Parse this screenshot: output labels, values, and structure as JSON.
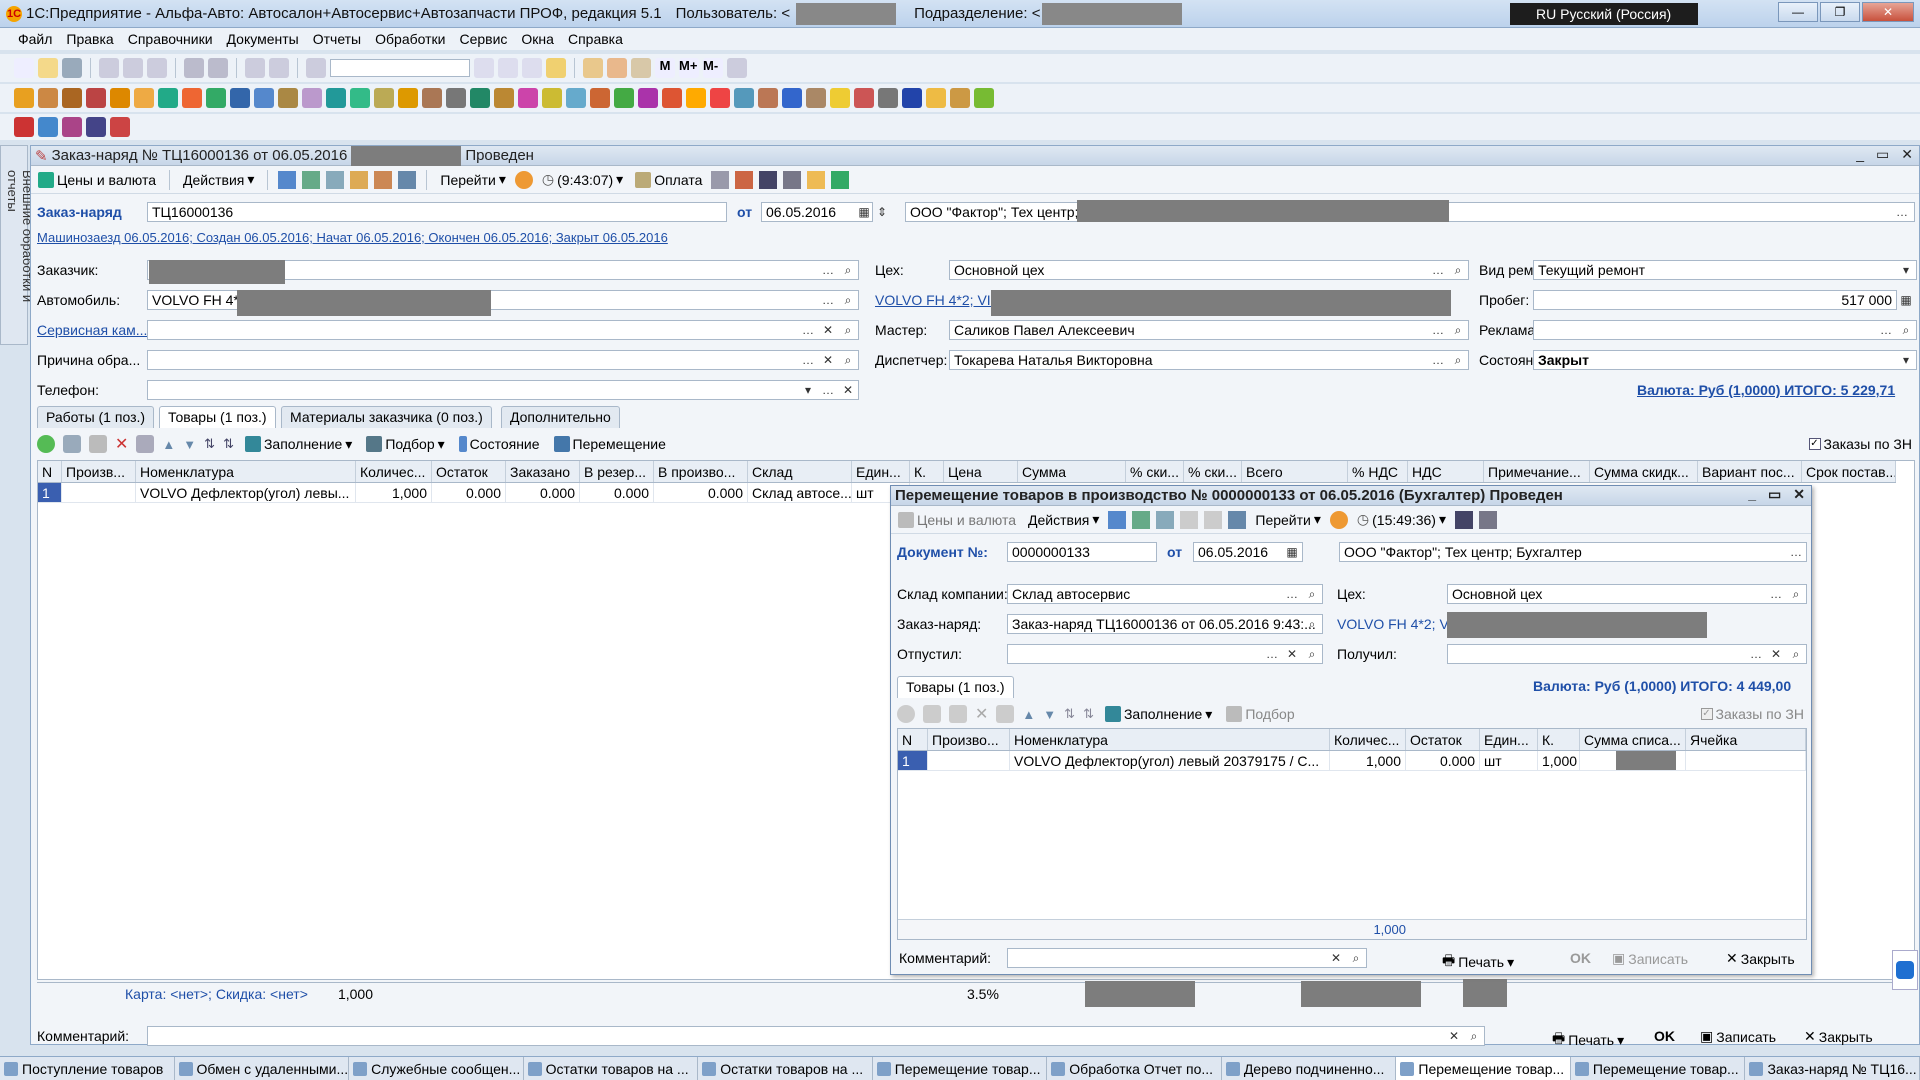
{
  "app": {
    "title": "1С:Предприятие - Альфа-Авто: Автосалон+Автосервис+Автозапчасти ПРОФ, редакция 5.1",
    "user_label": "Пользователь: <",
    "division_label": "Подразделение: <",
    "language": "RU Русский (Россия)"
  },
  "menu": [
    "Файл",
    "Правка",
    "Справочники",
    "Документы",
    "Отчеты",
    "Обработки",
    "Сервис",
    "Окна",
    "Справка"
  ],
  "side_panel": {
    "label": "Внешние обработки и отчеты"
  },
  "order": {
    "title": "Заказ-наряд № ТЦ16000136 от 06.05.2016",
    "status_suffix": "Проведен",
    "toolbar": {
      "prices": "Цены и валюта",
      "actions": "Действия",
      "goto": "Перейти",
      "time": "(9:43:07)",
      "payment": "Оплата"
    },
    "number_label": "Заказ-наряд",
    "number": "ТЦ16000136",
    "date_label": "от",
    "date": "06.05.2016",
    "org": "ООО \"Фактор\"; Тех центр;",
    "history_link": "Машинозаезд 06.05.2016; Создан 06.05.2016; Начат 06.05.2016; Окончен 06.05.2016; Закрыт 06.05.2016",
    "customer_label": "Заказчик:",
    "car_label": "Автомобиль:",
    "car": "VOLVO FH 4*2",
    "service_label": "Сервисная кам...",
    "reason_label": "Причина обра...",
    "phone_label": "Телефон:",
    "shop_label": "Цех:",
    "shop": "Основной цех",
    "car_link": "VOLVO FH 4*2; VIN",
    "master_label": "Мастер:",
    "master": "Саликов Павел Алексеевич",
    "dispatcher_label": "Диспетчер:",
    "dispatcher": "Токарева Наталья Викторовна",
    "repair_type_label": "Вид ремонт...",
    "repair_type": "Текущий ремонт",
    "mileage_label": "Пробег:",
    "mileage": "517 000",
    "ads_label": "Реклама:",
    "state_label": "Состояние:",
    "state": "Закрыт",
    "currency_link": "Валюта: Руб (1,0000) ИТОГО: 5 229,71",
    "tabs": [
      "Работы (1 поз.)",
      "Товары (1 поз.)",
      "Материалы заказчика (0 поз.)",
      "Дополнительно"
    ],
    "grid_tool": {
      "fill": "Заполнение",
      "pick": "Подбор",
      "state": "Состояние",
      "move": "Перемещение",
      "orders_check": "Заказы по ЗН"
    },
    "columns": [
      "N",
      "Произв...",
      "Номенклатура",
      "Количес...",
      "Остаток",
      "Заказано",
      "В резер...",
      "В произво...",
      "Склад",
      "Един...",
      "К.",
      "Цена",
      "Сумма",
      "% ски...",
      "% ски...",
      "Всего",
      "% НДС",
      "НДС",
      "Примечание...",
      "Сумма скидк...",
      "Вариант пос...",
      "Срок постав..."
    ],
    "row": [
      "1",
      "",
      "VOLVO Дефлектор(угол) левы...",
      "1,000",
      "0.000",
      "0.000",
      "0.000",
      "0.000",
      "Склад автосе...",
      "шт"
    ],
    "footer": {
      "card": "Карта: <нет>; Скидка: <нет>",
      "qty": "1,000",
      "vat": "3.5%"
    },
    "comment_label": "Комментарий:",
    "buttons": {
      "print": "Печать",
      "ok": "OK",
      "save": "Записать",
      "close": "Закрыть"
    }
  },
  "transfer": {
    "title": "Перемещение товаров в производство № 0000000133 от 06.05.2016 (Бухгалтер) Проведен",
    "toolbar": {
      "prices": "Цены и валюта",
      "actions": "Действия",
      "goto": "Перейти",
      "time": "(15:49:36)"
    },
    "doc_label": "Документ №:",
    "doc_number": "0000000133",
    "date_label": "от",
    "date": "06.05.2016",
    "org": "ООО \"Фактор\"; Тех центр; Бухгалтер",
    "warehouse_label": "Склад компании:",
    "warehouse": "Склад автосервис",
    "shop_label": "Цех:",
    "shop": "Основной цех",
    "order_label": "Заказ-наряд:",
    "order": "Заказ-наряд ТЦ16000136 от 06.05.2016 9:43:...",
    "car_link": "VOLVO FH 4*2; VIN",
    "released_label": "Отпустил:",
    "received_label": "Получил:",
    "tab": "Товары (1 поз.)",
    "currency": "Валюта: Руб (1,0000) ИТОГО: 4 449,00",
    "grid_tool": {
      "fill": "Заполнение",
      "pick": "Подбор",
      "orders_check": "Заказы по ЗН"
    },
    "columns": [
      "N",
      "Произво...",
      "Номенклатура",
      "Количес...",
      "Остаток",
      "Един...",
      "К.",
      "Сумма списа...",
      "Ячейка"
    ],
    "row": [
      "1",
      "",
      "VOLVO Дефлектор(угол) левый   20379175 / С...",
      "1,000",
      "0.000",
      "шт",
      "1,000",
      "",
      ""
    ],
    "total_qty": "1,000",
    "comment_label": "Комментарий:",
    "buttons": {
      "print": "Печать",
      "ok": "OK",
      "save": "Записать",
      "close": "Закрыть"
    }
  },
  "taskbar": [
    "Поступление товаров",
    "Обмен с удаленными...",
    "Служебные сообщен...",
    "Остатки товаров на ...",
    "Остатки товаров на ...",
    "Перемещение товар...",
    "Обработка Отчет по...",
    "Дерево подчиненно...",
    "Перемещение товар...",
    "Перемещение товар...",
    "Заказ-наряд № ТЦ16..."
  ]
}
